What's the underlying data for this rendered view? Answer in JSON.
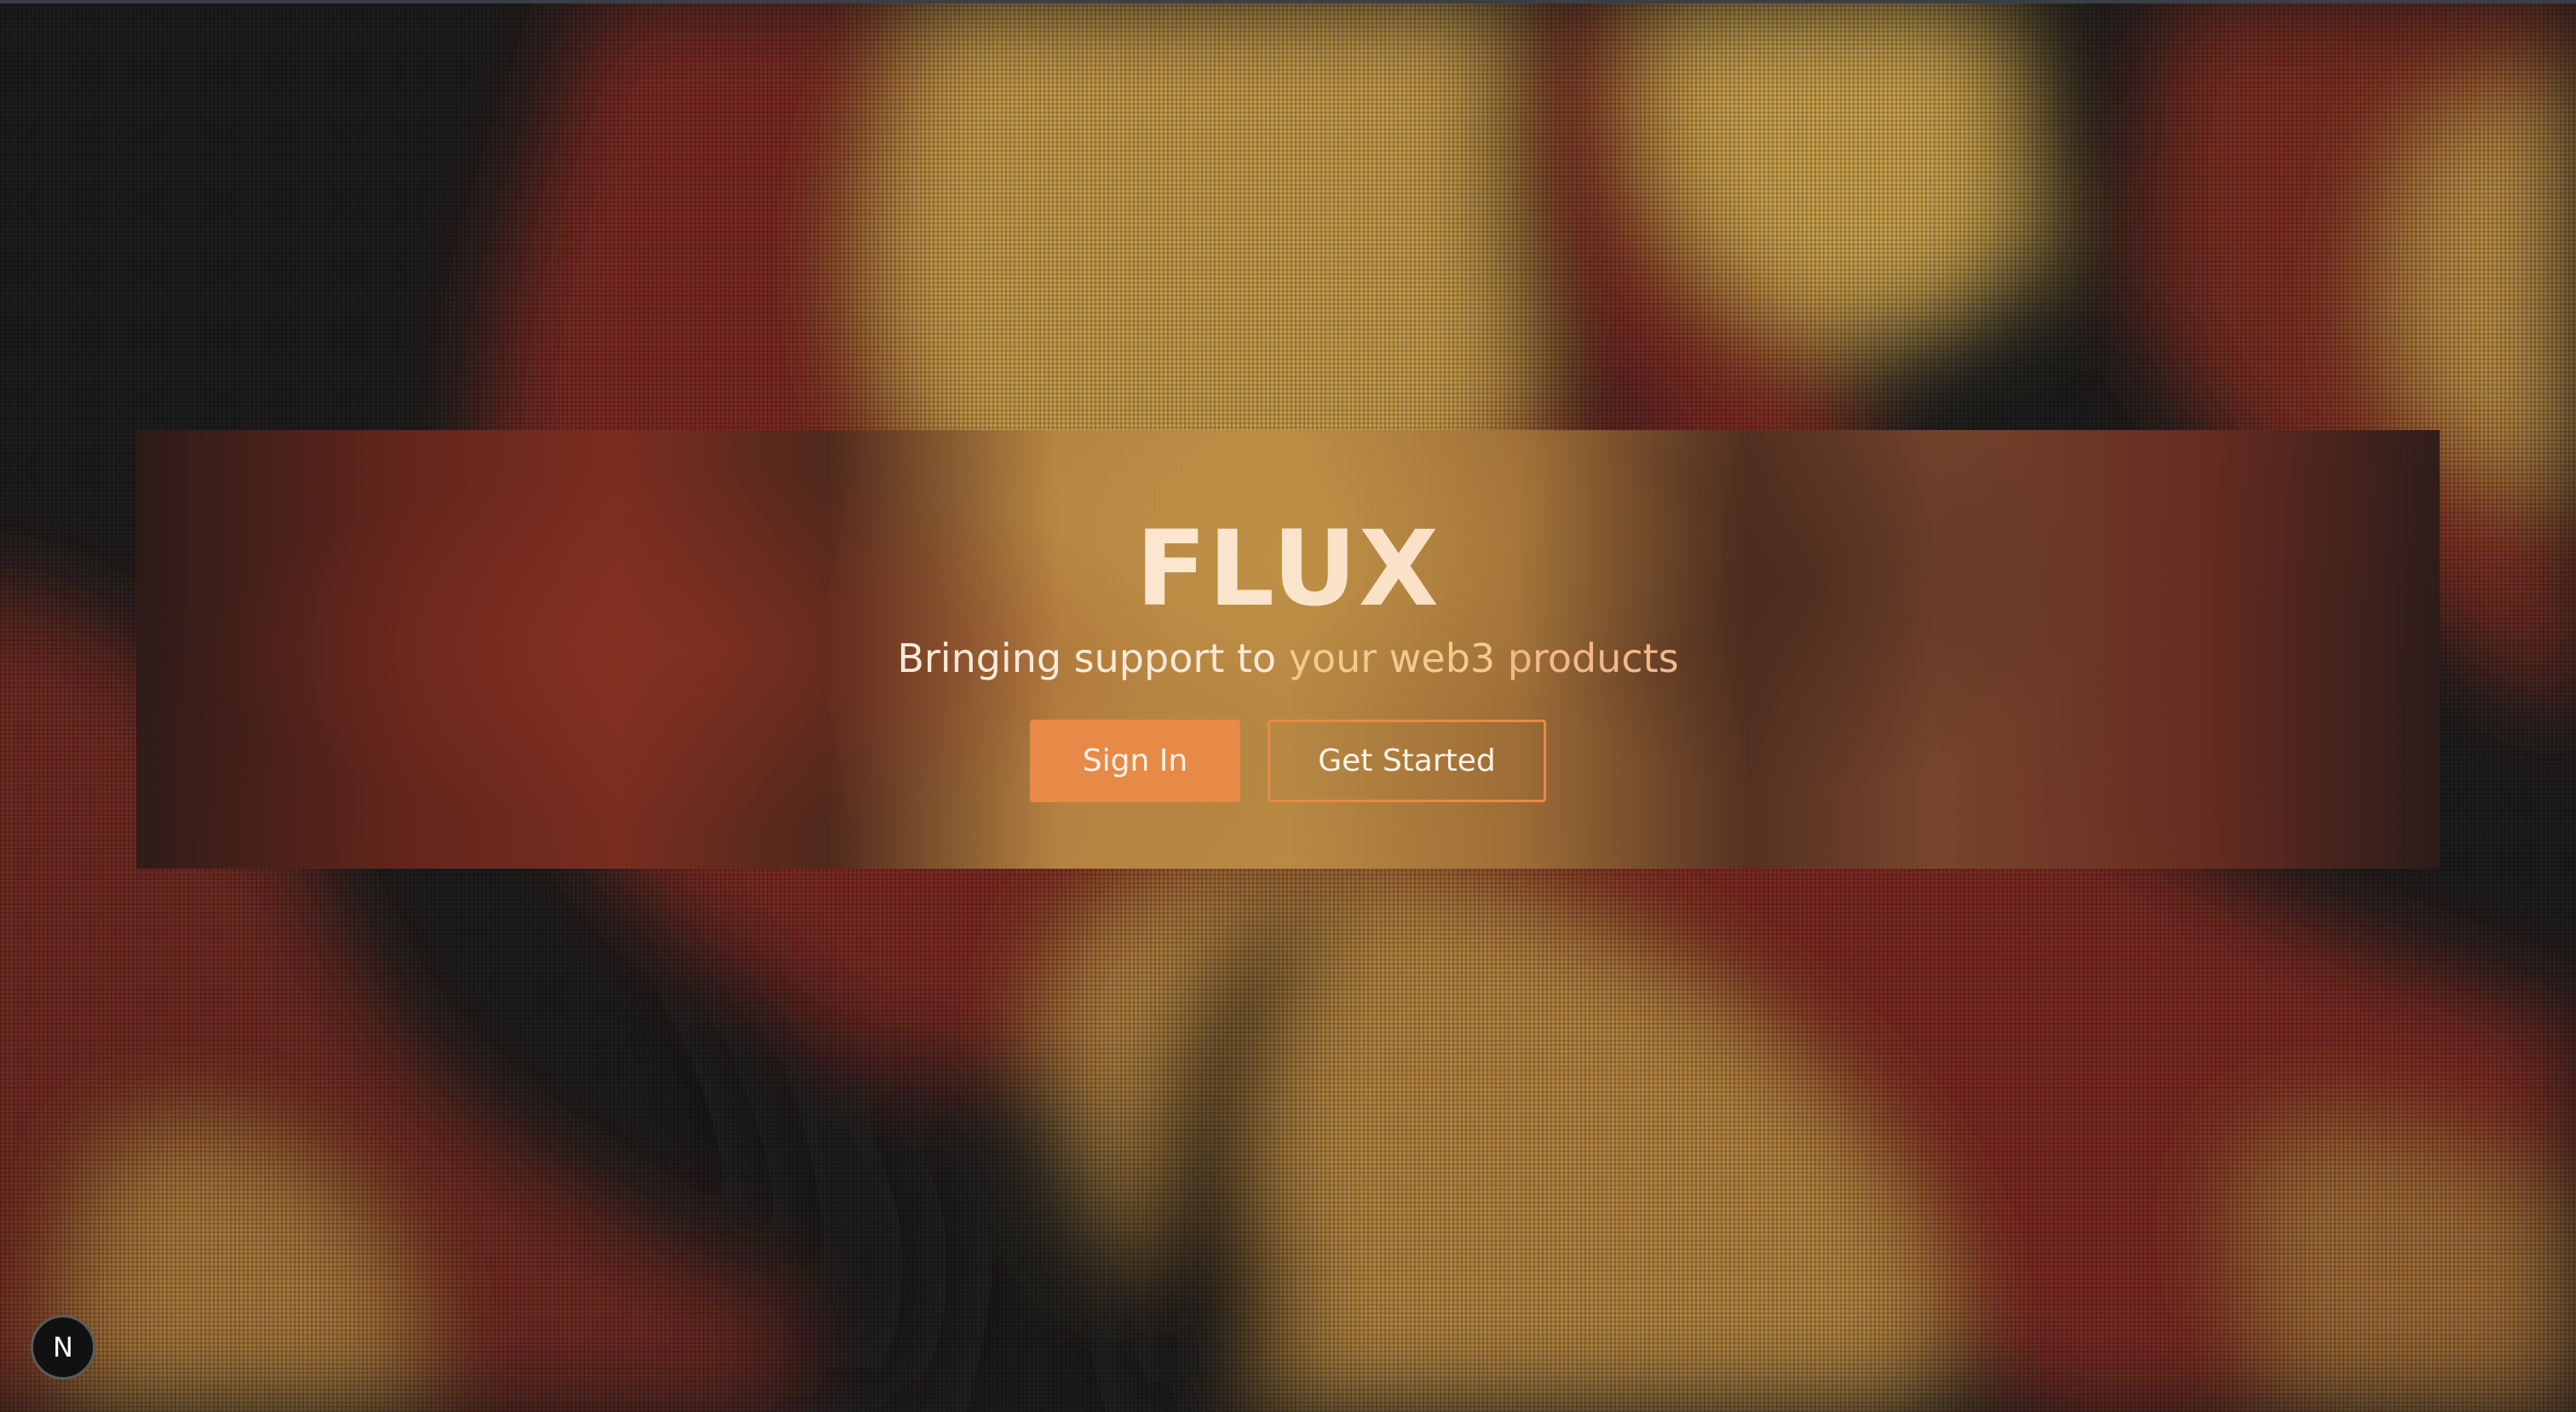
{
  "hero": {
    "title": "FLUX",
    "subtitle_part1": "Bringing support to ",
    "subtitle_part2": "your web3 ",
    "subtitle_part3": "products"
  },
  "actions": {
    "sign_in_label": "Sign In",
    "get_started_label": "Get Started"
  },
  "nextjs_badge": {
    "letter": "N",
    "icon": "nextjs-logo-icon"
  },
  "colors": {
    "accent": "#e88a47",
    "background_dark": "#1d1d1d",
    "background_red": "#7a2c22",
    "background_gold": "#c49a48"
  }
}
